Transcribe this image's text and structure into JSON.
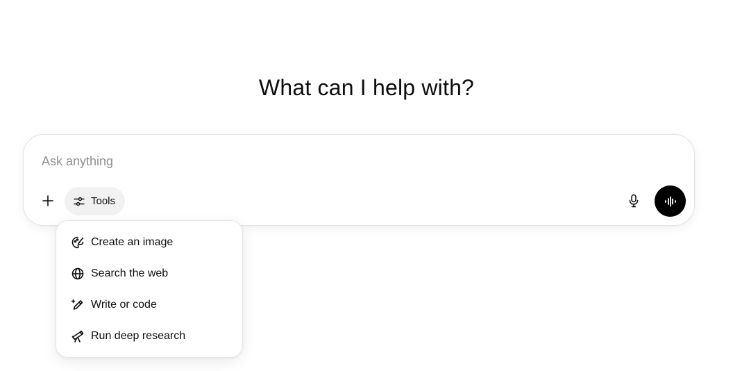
{
  "main": {
    "heading": "What can I help with?"
  },
  "composer": {
    "placeholder": "Ask anything",
    "value": "",
    "tools_label": "Tools",
    "icons": {
      "add": "plus-icon",
      "tools": "sliders-icon",
      "mic": "microphone-icon",
      "voice": "voice-waveform-icon"
    }
  },
  "tools_menu": {
    "items": [
      {
        "label": "Create an image",
        "icon": "palette-icon"
      },
      {
        "label": "Search the web",
        "icon": "globe-icon"
      },
      {
        "label": "Write or code",
        "icon": "pen-sparkle-icon"
      },
      {
        "label": "Run deep research",
        "icon": "telescope-icon"
      }
    ]
  },
  "colors": {
    "text": "#0d0d0d",
    "placeholder": "#8f8f8f",
    "tools_bg": "#f1f1f1",
    "voice_button": "#000000",
    "border": "#e3e3e3"
  }
}
